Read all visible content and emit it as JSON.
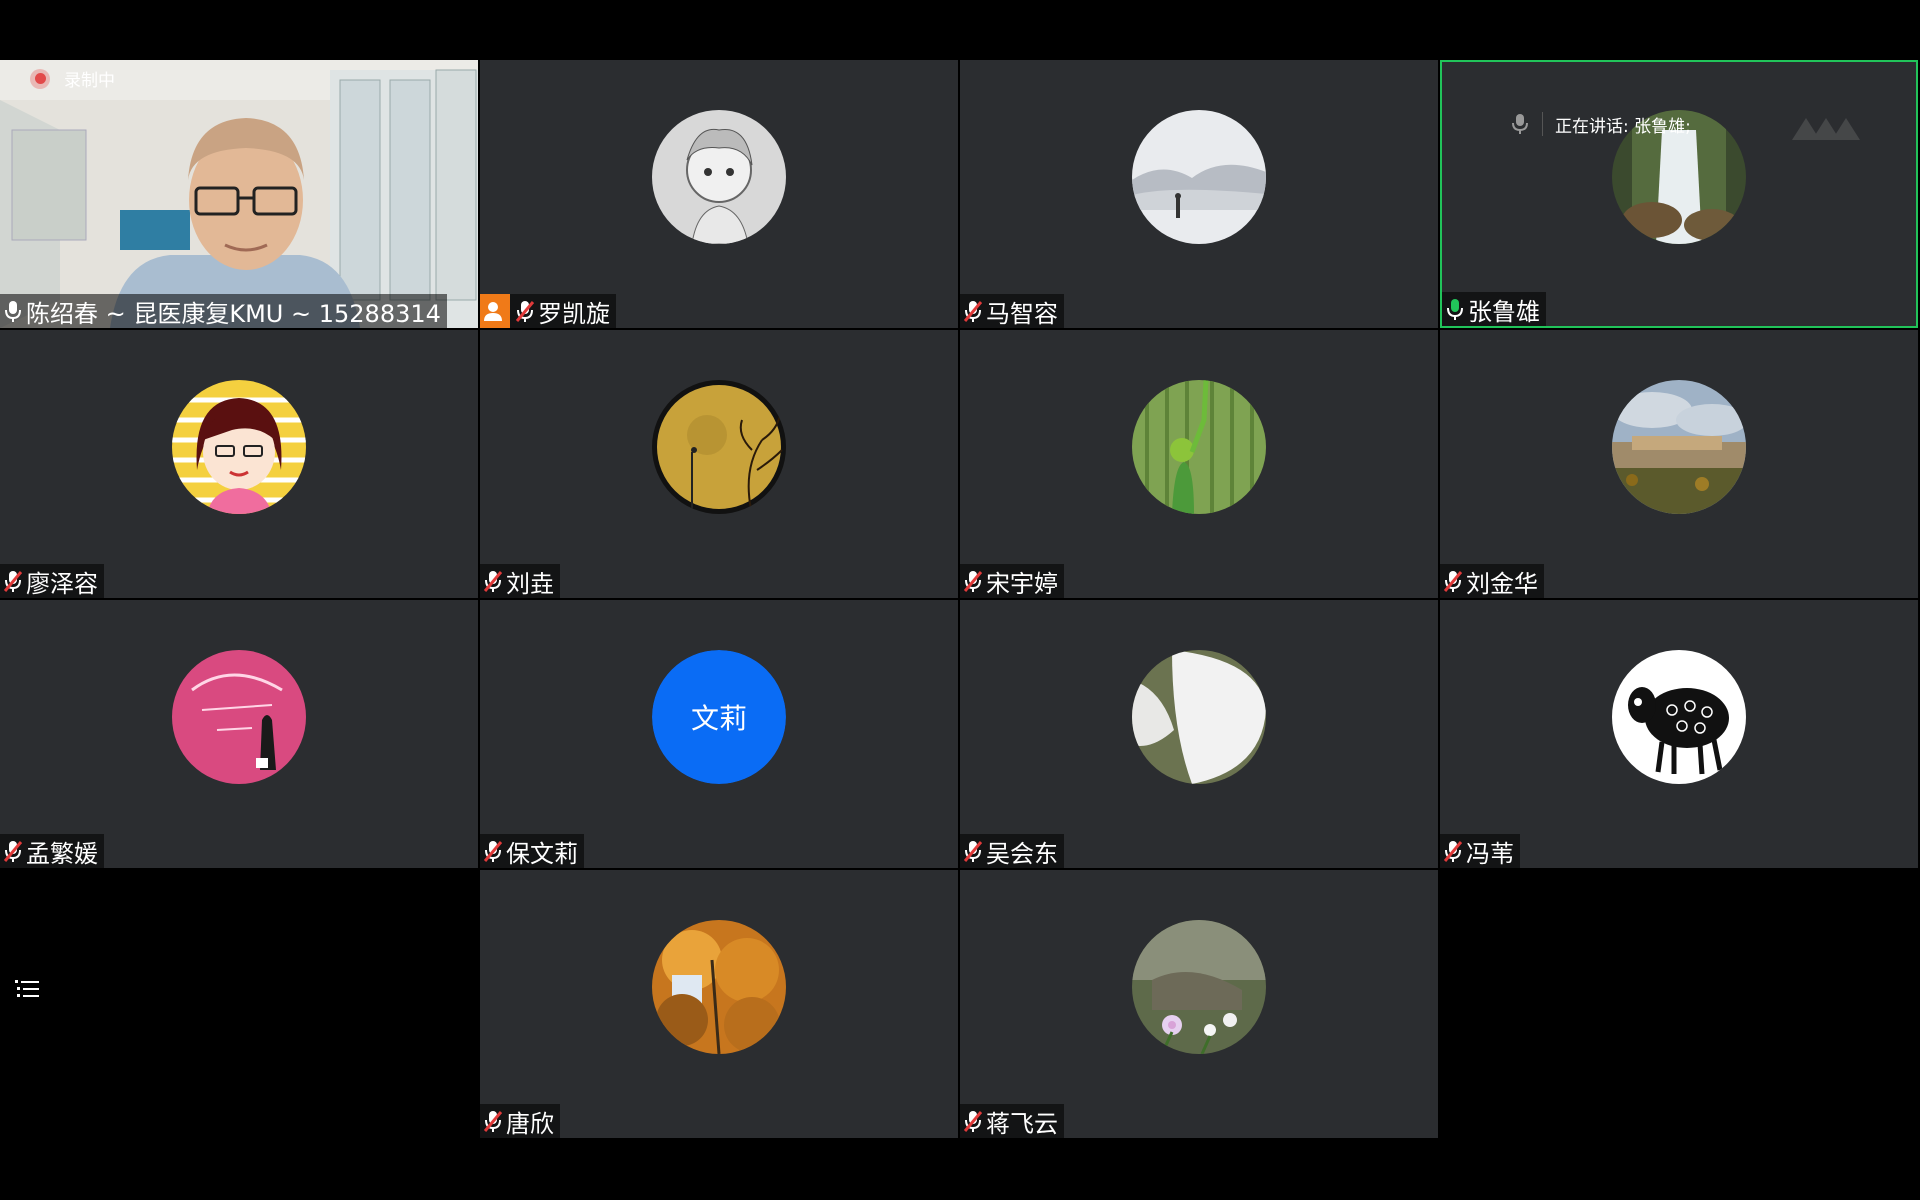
{
  "recording": {
    "label": "录制中"
  },
  "speaking": {
    "text": "正在讲话: 张鲁雄;"
  },
  "participants": [
    {
      "name": "陈绍春 ~ 昆医康复KMU ~ 15288314",
      "mic": "on"
    },
    {
      "name": "罗凯旋",
      "mic": "off",
      "host": true
    },
    {
      "name": "马智容",
      "mic": "off"
    },
    {
      "name": "张鲁雄",
      "mic": "on",
      "active": true
    },
    {
      "name": "廖泽容",
      "mic": "off"
    },
    {
      "name": "刘垚",
      "mic": "off"
    },
    {
      "name": "宋宇婷",
      "mic": "off"
    },
    {
      "name": "刘金华",
      "mic": "off"
    },
    {
      "name": "孟繁媛",
      "mic": "off"
    },
    {
      "name": "保文莉",
      "mic": "off",
      "avatar_text": "文莉"
    },
    {
      "name": "吴会东",
      "mic": "off"
    },
    {
      "name": "冯苇",
      "mic": "off"
    },
    {
      "name": "唐欣",
      "mic": "off"
    },
    {
      "name": "蒋飞云",
      "mic": "off"
    }
  ],
  "colors": {
    "tile_bg": "#2b2d30",
    "active_border": "#21c45a",
    "host_badge": "#f07a18",
    "avatar_blue": "#0a6cf5",
    "mic_off": "#e03a3a"
  }
}
